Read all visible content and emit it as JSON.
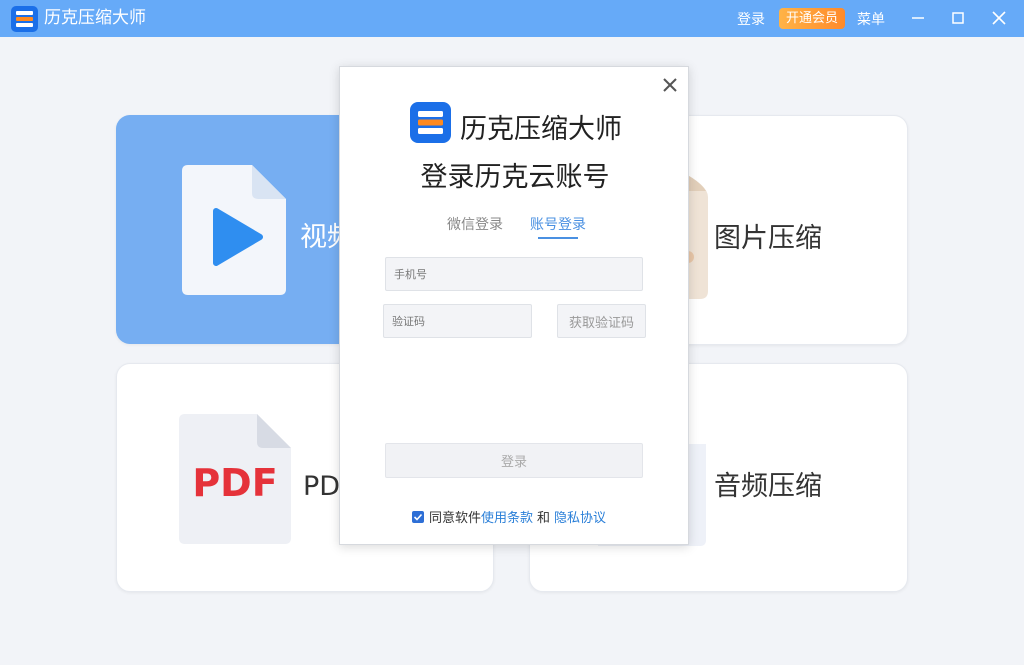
{
  "titlebar": {
    "app_title": "历克压缩大师",
    "login": "登录",
    "vip": "开通会员",
    "menu": "菜单",
    "icons": [
      "app-logo-icon",
      "minimize-icon",
      "maximize-icon",
      "close-icon"
    ]
  },
  "cards": {
    "video": {
      "label": "视频压缩",
      "icon": "video-file-icon"
    },
    "image": {
      "label": "图片压缩",
      "icon": "image-file-icon"
    },
    "pdf": {
      "label": "PDF压缩",
      "icon": "pdf-file-icon",
      "icon_text": "PDF"
    },
    "audio": {
      "label": "音频压缩",
      "icon": "audio-file-icon"
    }
  },
  "dialog": {
    "app_name": "历克压缩大师",
    "title": "登录历克云账号",
    "tabs": [
      {
        "label": "微信登录",
        "active": false
      },
      {
        "label": "账号登录",
        "active": true
      }
    ],
    "phone_placeholder": "手机号",
    "code_placeholder": "验证码",
    "get_code": "获取验证码",
    "login_button": "登录",
    "agree_text": "同意软件",
    "terms_link": "使用条款",
    "and_text": "和",
    "privacy_link": "隐私协议",
    "agree_checked": true
  },
  "colors": {
    "titlebar": "#66aaf8",
    "accent": "#4a90e2",
    "video_card": "#76aef2",
    "vip_badge": "#ff9a36"
  }
}
